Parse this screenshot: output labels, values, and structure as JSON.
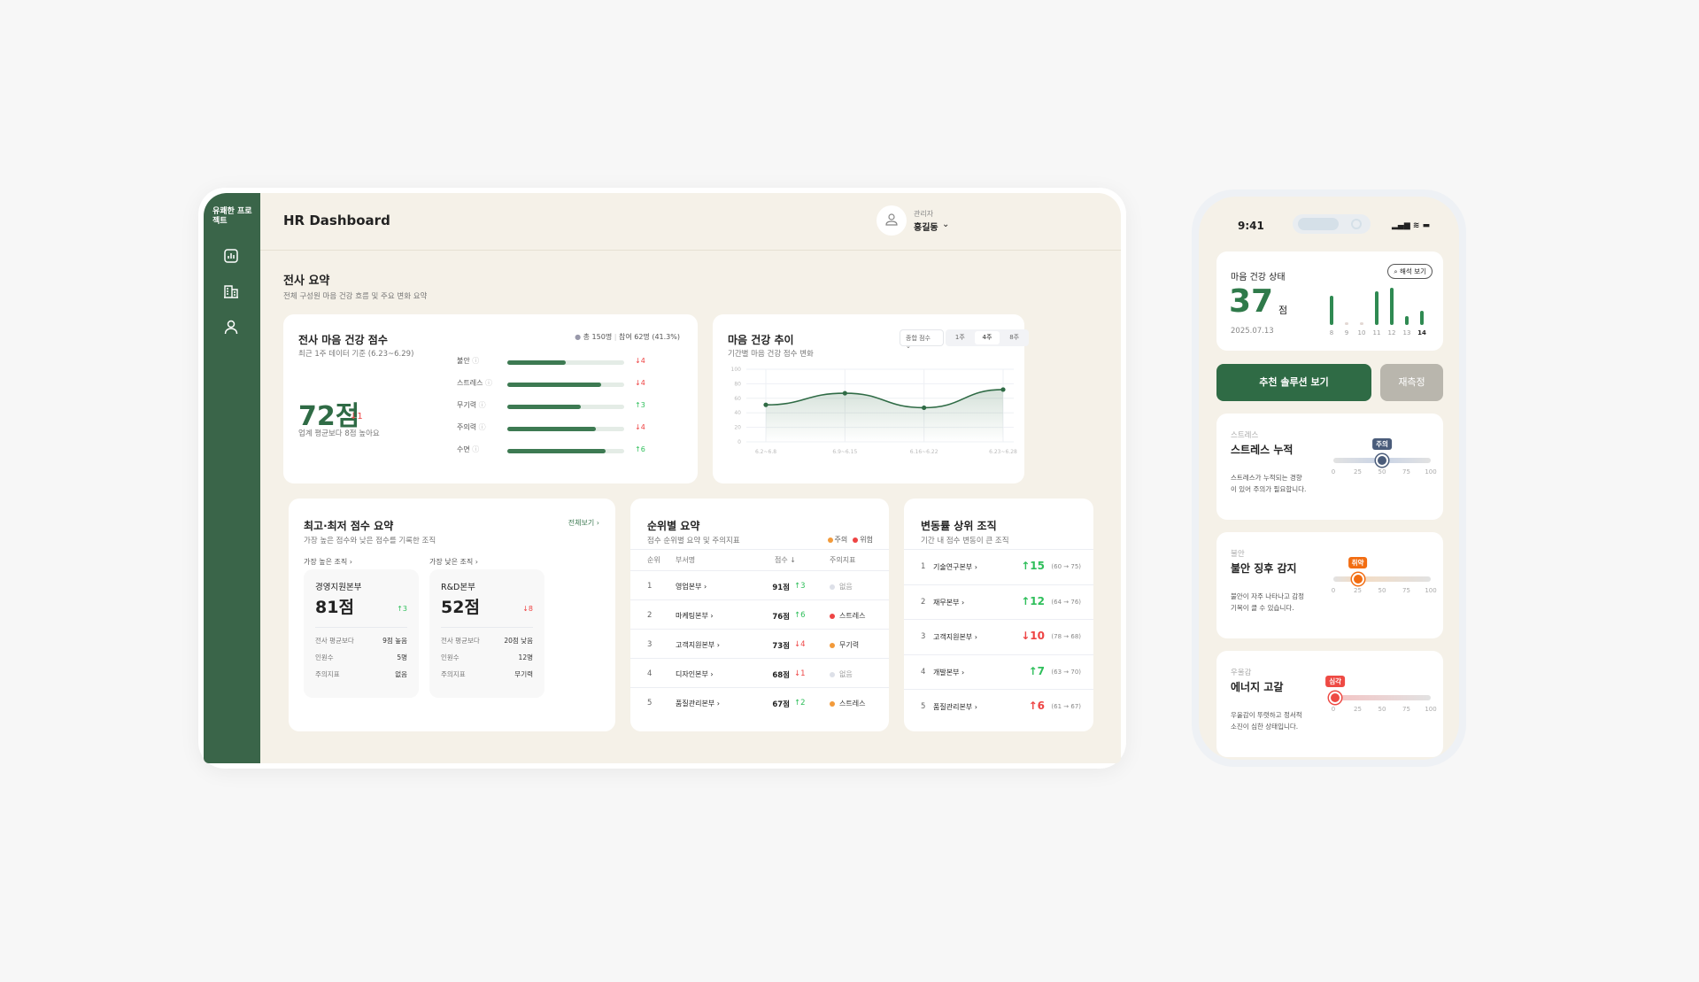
{
  "app": {
    "logo": "유쾌한 프로젝트",
    "title": "HR Dashboard",
    "user_role": "관리자",
    "user_name": "홍길동"
  },
  "sidebar": {
    "items": [
      {
        "icon": "chart-icon"
      },
      {
        "icon": "building-icon"
      },
      {
        "icon": "person-icon"
      }
    ]
  },
  "section": {
    "title": "전사 요약",
    "subtitle": "전체 구성원 마음 건강 흐름 및 주요 변화 요약"
  },
  "score_card": {
    "title": "전사 마음 건강 점수",
    "subtitle": "최근 1주 데이터 기준 (6.23~6.29)",
    "total": "총 150명",
    "participation": "참여 62명 (41.3%)",
    "score": "72점",
    "delta": "↓1",
    "note": "업계 평균보다 8점 높아요",
    "metrics": [
      {
        "label": "불안",
        "value": 50,
        "delta": "↓4",
        "dir": "down"
      },
      {
        "label": "스트레스",
        "value": 80,
        "delta": "↓4",
        "dir": "down"
      },
      {
        "label": "무기력",
        "value": 63,
        "delta": "↑3",
        "dir": "up"
      },
      {
        "label": "주의력",
        "value": 76,
        "delta": "↓4",
        "dir": "down"
      },
      {
        "label": "수면",
        "value": 84,
        "delta": "↑6",
        "dir": "up"
      }
    ]
  },
  "trend_card": {
    "title": "마음 건강 추이",
    "subtitle": "기간별 마음 건강 점수 변화",
    "select": "종합 점수",
    "periods": [
      "1주",
      "4주",
      "8주"
    ],
    "active_period": "4주"
  },
  "chart_data": {
    "type": "area",
    "categories": [
      "6.2~6.8",
      "6.9~6.15",
      "6.16~6.22",
      "6.23~6.28"
    ],
    "values": [
      51,
      67,
      47,
      72
    ],
    "ylim": [
      0,
      100
    ],
    "yticks": [
      0,
      20,
      40,
      60,
      80,
      100
    ],
    "grid": true,
    "color": "#2f6b45"
  },
  "best_worst": {
    "title": "최고·최저 점수 요약",
    "subtitle": "가장 높은 점수와 낮은 점수를 기록한 조직",
    "view_all": "전체보기",
    "high": {
      "label": "가장 높은 조직",
      "name": "경영지원본부",
      "score": "81점",
      "delta": "↑3",
      "rows": [
        [
          "전사 평균보다",
          "9점 높음"
        ],
        [
          "인원수",
          "5명"
        ],
        [
          "주의지표",
          "없음"
        ]
      ]
    },
    "low": {
      "label": "가장 낮은 조직",
      "name": "R&D본부",
      "score": "52점",
      "delta": "↓8",
      "rows": [
        [
          "전사 평균보다",
          "20점 낮음"
        ],
        [
          "인원수",
          "12명"
        ],
        [
          "주의지표",
          "무기력"
        ]
      ]
    }
  },
  "rank": {
    "title": "순위별 요약",
    "subtitle": "점수 순위별 요약 및 주의지표",
    "legend": [
      {
        "label": "주의",
        "color": "#f29a3a"
      },
      {
        "label": "위험",
        "color": "#ee4444"
      }
    ],
    "headers": [
      "순위",
      "부서명",
      "점수 ↓",
      "주의지표"
    ],
    "rows": [
      {
        "rank": "1",
        "name": "영업본부",
        "score": "91점",
        "delta": "↑3",
        "dir": "up",
        "flag": "없음",
        "level": "none"
      },
      {
        "rank": "2",
        "name": "마케팅본부",
        "score": "76점",
        "delta": "↑6",
        "dir": "up",
        "flag": "스트레스",
        "level": "danger"
      },
      {
        "rank": "3",
        "name": "고객지원본부",
        "score": "73점",
        "delta": "↓4",
        "dir": "down",
        "flag": "무기력",
        "level": "warn"
      },
      {
        "rank": "4",
        "name": "디자인본부",
        "score": "68점",
        "delta": "↓1",
        "dir": "down",
        "flag": "없음",
        "level": "none"
      },
      {
        "rank": "5",
        "name": "품질관리본부",
        "score": "67점",
        "delta": "↑2",
        "dir": "up",
        "flag": "스트레스",
        "level": "warn"
      }
    ]
  },
  "change": {
    "title": "변동률 상위 조직",
    "subtitle": "기간 내 점수 변동이 큰 조직",
    "rows": [
      {
        "rank": "1",
        "name": "기술연구본부",
        "delta": "↑15",
        "dir": "up",
        "range": "(60 → 75)"
      },
      {
        "rank": "2",
        "name": "재무본부",
        "delta": "↑12",
        "dir": "up",
        "range": "(64 → 76)"
      },
      {
        "rank": "3",
        "name": "고객지원본부",
        "delta": "↓10",
        "dir": "down",
        "range": "(78 → 68)"
      },
      {
        "rank": "4",
        "name": "개발본부",
        "delta": "↑7",
        "dir": "up",
        "range": "(63 → 70)"
      },
      {
        "rank": "5",
        "name": "품질관리본부",
        "delta": "↑6",
        "dir": "down",
        "range": "(61 → 67)"
      }
    ]
  },
  "phone": {
    "time": "9:41",
    "status_title": "마음 건강 상태",
    "interpret": "해석 보기",
    "score": "37",
    "unit": "점",
    "date": "2025.07.13",
    "days": [
      {
        "d": "8",
        "v": 78
      },
      {
        "d": "9",
        "v": 0
      },
      {
        "d": "10",
        "v": 0
      },
      {
        "d": "11",
        "v": 90
      },
      {
        "d": "12",
        "v": 100
      },
      {
        "d": "13",
        "v": 25
      },
      {
        "d": "14",
        "v": 37
      }
    ],
    "primary_btn": "추천 솔루션 보기",
    "secondary_btn": "재측정",
    "scale": [
      "0",
      "25",
      "50",
      "75",
      "100"
    ],
    "cards": [
      {
        "category": "스트레스",
        "title": "스트레스 누적",
        "desc1": "스트레스가 누적되는 경향",
        "desc2": "이 있어 주의가 필요합니다.",
        "tag": "주의",
        "value": 50,
        "color": "#4a5c7a",
        "track": "#c9d4e6"
      },
      {
        "category": "불안",
        "title": "불안 징후 감지",
        "desc1": "불안이 자주 나타나고 감정",
        "desc2": "기복이 클 수 있습니다.",
        "tag": "취약",
        "value": 25,
        "color": "#f26d12",
        "track": "#f4dcc3"
      },
      {
        "category": "우울감",
        "title": "에너지 고갈",
        "desc1": "우울감이 뚜렷하고 정서적",
        "desc2": "소진이 심한 상태입니다.",
        "tag": "심각",
        "value": 2,
        "color": "#ee4a44",
        "track": "#f4c4c4"
      }
    ]
  }
}
